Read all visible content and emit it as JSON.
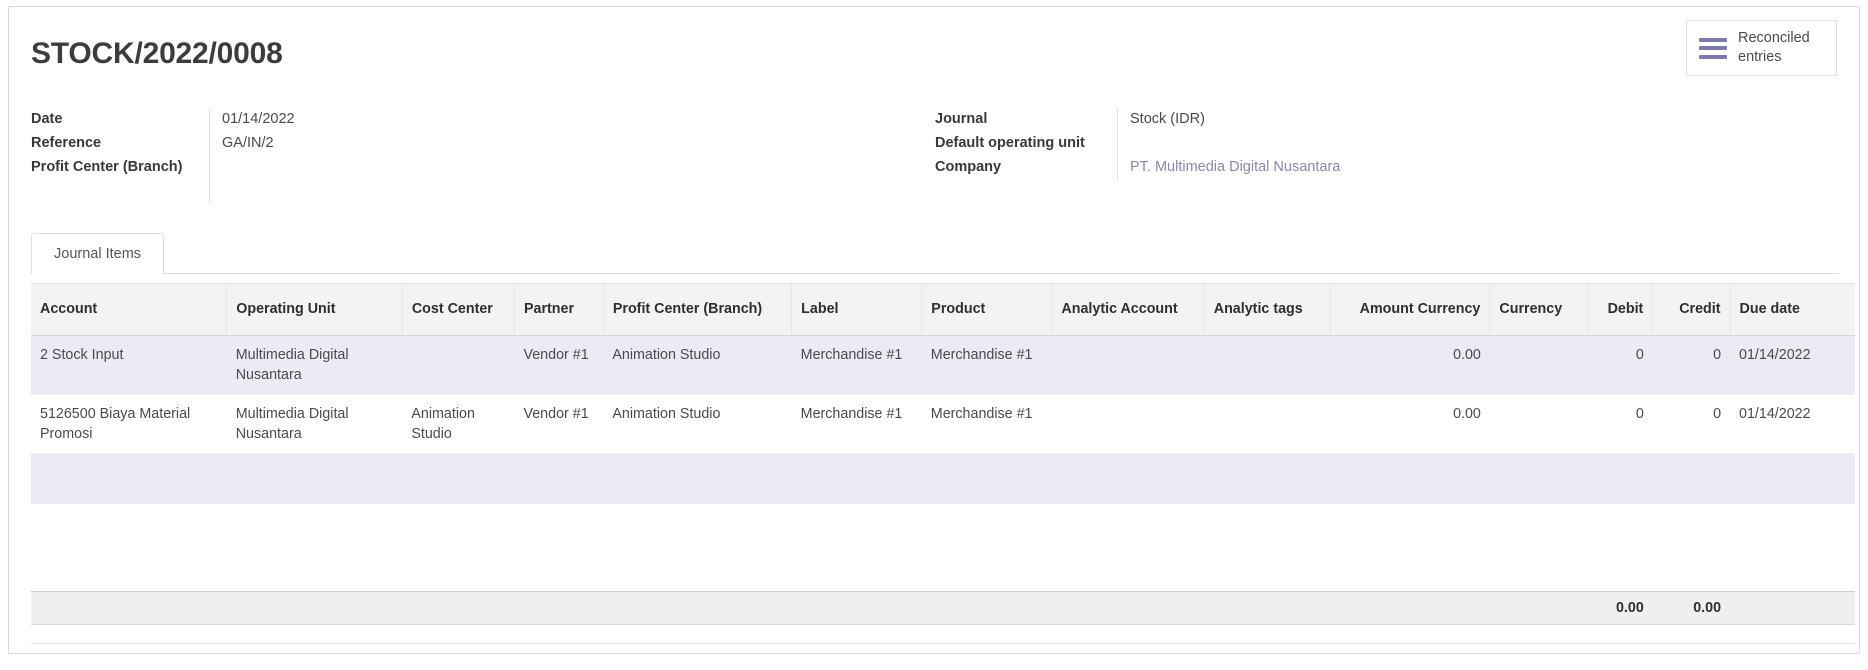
{
  "record": {
    "title": "STOCK/2022/0008"
  },
  "stat_buttons": [
    {
      "icon": "list-bars-icon",
      "label": "Reconciled entries"
    }
  ],
  "fields_left": [
    {
      "label": "Date",
      "value": "01/14/2022",
      "style": "plain"
    },
    {
      "label": "Reference",
      "value": "GA/IN/2",
      "style": "plain"
    },
    {
      "label": "Profit Center (Branch)",
      "value": "",
      "style": "plain"
    }
  ],
  "fields_right": [
    {
      "label": "Journal",
      "value": "Stock (IDR)",
      "style": "plain"
    },
    {
      "label": "Default operating unit",
      "value": "",
      "style": "plain"
    },
    {
      "label": "Company",
      "value": "PT. Multimedia Digital Nusantara",
      "style": "link"
    }
  ],
  "notebook": {
    "tabs": [
      {
        "label": "Journal Items",
        "active": true
      }
    ]
  },
  "grid": {
    "columns": [
      {
        "label": "Account",
        "align": "left"
      },
      {
        "label": "Operating Unit",
        "align": "left"
      },
      {
        "label": "Cost Center",
        "align": "left"
      },
      {
        "label": "Partner",
        "align": "left"
      },
      {
        "label": "Profit Center (Branch)",
        "align": "left"
      },
      {
        "label": "Label",
        "align": "left"
      },
      {
        "label": "Product",
        "align": "left"
      },
      {
        "label": "Analytic Account",
        "align": "left"
      },
      {
        "label": "Analytic tags",
        "align": "left"
      },
      {
        "label": "Amount Currency",
        "align": "right"
      },
      {
        "label": "Currency",
        "align": "left"
      },
      {
        "label": "Debit",
        "align": "right"
      },
      {
        "label": "Credit",
        "align": "right"
      },
      {
        "label": "Due date",
        "align": "left"
      }
    ],
    "rows": [
      {
        "account": "2 Stock Input",
        "operating_unit": "Multimedia Digital Nusantara",
        "cost_center": "",
        "partner": "Vendor #1",
        "profit_center": "Animation Studio",
        "label": "Merchandise #1",
        "product": "Merchandise #1",
        "analytic_account": "",
        "analytic_tags": "",
        "amount_currency": "0.00",
        "currency": "",
        "debit": "0",
        "credit": "0",
        "due_date": "01/14/2022"
      },
      {
        "account": "5126500 Biaya Material Promosi",
        "operating_unit": "Multimedia Digital Nusantara",
        "cost_center": "Animation Studio",
        "partner": "Vendor #1",
        "profit_center": "Animation Studio",
        "label": "Merchandise #1",
        "product": "Merchandise #1",
        "analytic_account": "",
        "analytic_tags": "",
        "amount_currency": "0.00",
        "currency": "",
        "debit": "0",
        "credit": "0",
        "due_date": "01/14/2022"
      }
    ],
    "totals": {
      "debit": "0.00",
      "credit": "0.00"
    }
  }
}
